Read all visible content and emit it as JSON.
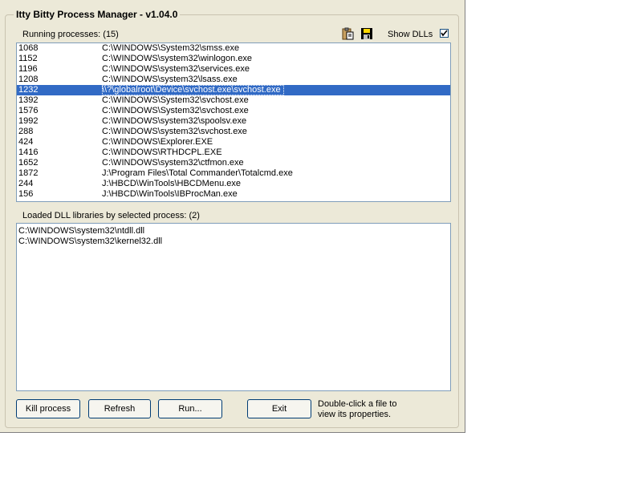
{
  "window": {
    "title": "Itty Bitty Process Manager - v1.04.0"
  },
  "processes_label": "Running processes: (15)",
  "icons": {
    "copy": "clipboard-icon",
    "save": "floppy-disk-icon"
  },
  "show_dlls": {
    "label": "Show DLLs",
    "checked": true
  },
  "processes": [
    {
      "pid": "1068",
      "path": "C:\\WINDOWS\\System32\\smss.exe"
    },
    {
      "pid": "1152",
      "path": "C:\\WINDOWS\\system32\\winlogon.exe"
    },
    {
      "pid": "1196",
      "path": "C:\\WINDOWS\\system32\\services.exe"
    },
    {
      "pid": "1208",
      "path": "C:\\WINDOWS\\system32\\lsass.exe"
    },
    {
      "pid": "1232",
      "path": "\\\\?\\globalroot\\Device\\svchost.exe\\svchost.exe",
      "selected": true
    },
    {
      "pid": "1392",
      "path": "C:\\WINDOWS\\System32\\svchost.exe"
    },
    {
      "pid": "1576",
      "path": "C:\\WINDOWS\\System32\\svchost.exe"
    },
    {
      "pid": "1992",
      "path": "C:\\WINDOWS\\system32\\spoolsv.exe"
    },
    {
      "pid": "288",
      "path": "C:\\WINDOWS\\system32\\svchost.exe"
    },
    {
      "pid": "424",
      "path": "C:\\WINDOWS\\Explorer.EXE"
    },
    {
      "pid": "1416",
      "path": "C:\\WINDOWS\\RTHDCPL.EXE"
    },
    {
      "pid": "1652",
      "path": "C:\\WINDOWS\\system32\\ctfmon.exe"
    },
    {
      "pid": "1872",
      "path": "J:\\Program Files\\Total Commander\\Totalcmd.exe"
    },
    {
      "pid": "244",
      "path": "J:\\HBCD\\WinTools\\HBCDMenu.exe"
    },
    {
      "pid": "156",
      "path": "J:\\HBCD\\WinTools\\IBProcMan.exe"
    }
  ],
  "dll_label": "Loaded DLL libraries by selected process: (2)",
  "dlls": [
    "C:\\WINDOWS\\system32\\ntdll.dll",
    "C:\\WINDOWS\\system32\\kernel32.dll"
  ],
  "buttons": {
    "kill": "Kill process",
    "refresh": "Refresh",
    "run": "Run...",
    "exit": "Exit"
  },
  "hint": "Double-click a file to view its properties.",
  "colors": {
    "selection": "#316ac5",
    "face": "#ece9d8"
  }
}
